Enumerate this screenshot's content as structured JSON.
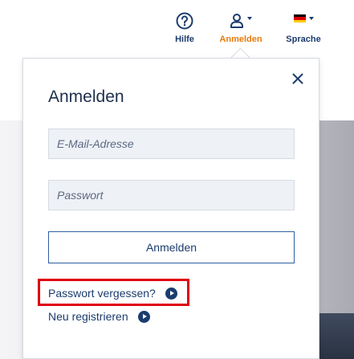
{
  "nav": {
    "help_label": "Hilfe",
    "login_label": "Anmelden",
    "language_label": "Sprache"
  },
  "colors": {
    "accent": "#e87a0c",
    "brand": "#1b3c6e",
    "highlight": "#e0000f"
  },
  "icons": {
    "help": "question-circle-icon",
    "user": "user-icon",
    "flag": "flag-de-icon",
    "close": "close-icon",
    "arrow": "arrow-circle-right-icon"
  },
  "login_popover": {
    "title": "Anmelden",
    "email_placeholder": "E-Mail-Adresse",
    "email_value": "",
    "password_placeholder": "Passwort",
    "password_value": "",
    "submit_label": "Anmelden",
    "forgot_password_label": "Passwort vergessen?",
    "register_label": "Neu registrieren"
  }
}
